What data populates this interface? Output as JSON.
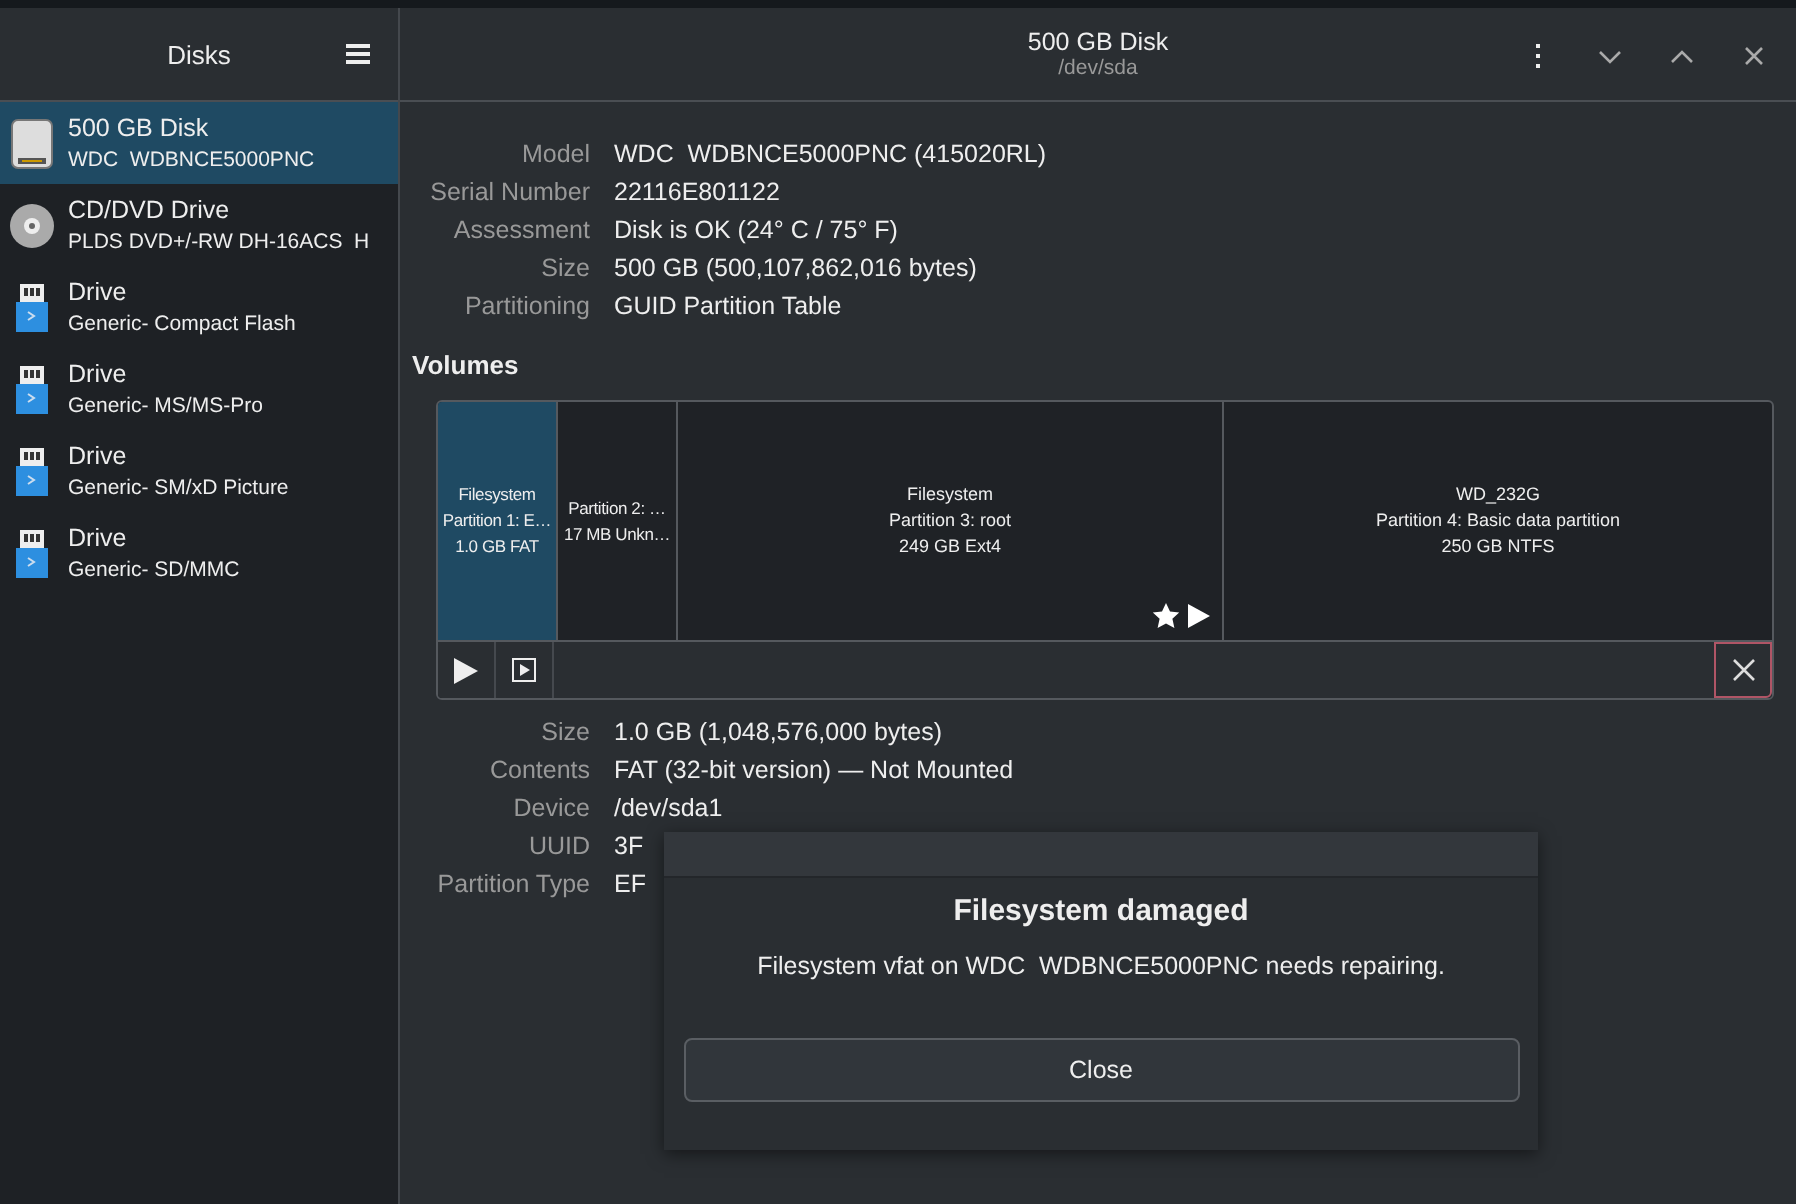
{
  "sidebar": {
    "title": "Disks",
    "devices": [
      {
        "kind": "hdd",
        "name": "500 GB Disk",
        "model": "WDC  WDBNCE5000PNC",
        "selected": true
      },
      {
        "kind": "optical",
        "name": "CD/DVD Drive",
        "model": "PLDS DVD+/-RW DH-16ACS  H",
        "selected": false
      },
      {
        "kind": "usb",
        "name": "Drive",
        "model": "Generic- Compact Flash",
        "selected": false
      },
      {
        "kind": "usb",
        "name": "Drive",
        "model": "Generic- MS/MS-Pro",
        "selected": false
      },
      {
        "kind": "usb",
        "name": "Drive",
        "model": "Generic- SM/xD Picture",
        "selected": false
      },
      {
        "kind": "usb",
        "name": "Drive",
        "model": "Generic- SD/MMC",
        "selected": false
      }
    ]
  },
  "header": {
    "title": "500 GB Disk",
    "subtitle": "/dev/sda"
  },
  "disk_info": [
    {
      "label": "Model",
      "value": "WDC  WDBNCE5000PNC (415020RL)"
    },
    {
      "label": "Serial Number",
      "value": "22116E801122"
    },
    {
      "label": "Assessment",
      "value": "Disk is OK (24° C / 75° F)"
    },
    {
      "label": "Size",
      "value": "500 GB (500,107,862,016 bytes)"
    },
    {
      "label": "Partitioning",
      "value": "GUID Partition Table"
    }
  ],
  "volumes": {
    "title": "Volumes",
    "partitions": [
      {
        "lines": [
          "Filesystem",
          "Partition 1: E…",
          "1.0 GB FAT"
        ],
        "selected": true,
        "flags": false
      },
      {
        "lines": [
          "Partition 2: …",
          "17 MB Unkn…"
        ],
        "selected": false,
        "flags": false
      },
      {
        "lines": [
          "Filesystem",
          "Partition 3: root",
          "249 GB Ext4"
        ],
        "selected": false,
        "flags": true
      },
      {
        "lines": [
          "WD_232G",
          "Partition 4: Basic data partition",
          "250 GB NTFS"
        ],
        "selected": false,
        "flags": false
      }
    ]
  },
  "volume_info": [
    {
      "label": "Size",
      "value": "1.0 GB (1,048,576,000 bytes)"
    },
    {
      "label": "Contents",
      "value": "FAT (32-bit version) — Not Mounted"
    },
    {
      "label": "Device",
      "value": "/dev/sda1"
    },
    {
      "label": "UUID",
      "value": "3F"
    },
    {
      "label": "Partition Type",
      "value": "EF"
    }
  ],
  "dialog": {
    "title": "Filesystem damaged",
    "message": "Filesystem vfat on WDC  WDBNCE5000PNC needs repairing.",
    "button": "Close"
  }
}
